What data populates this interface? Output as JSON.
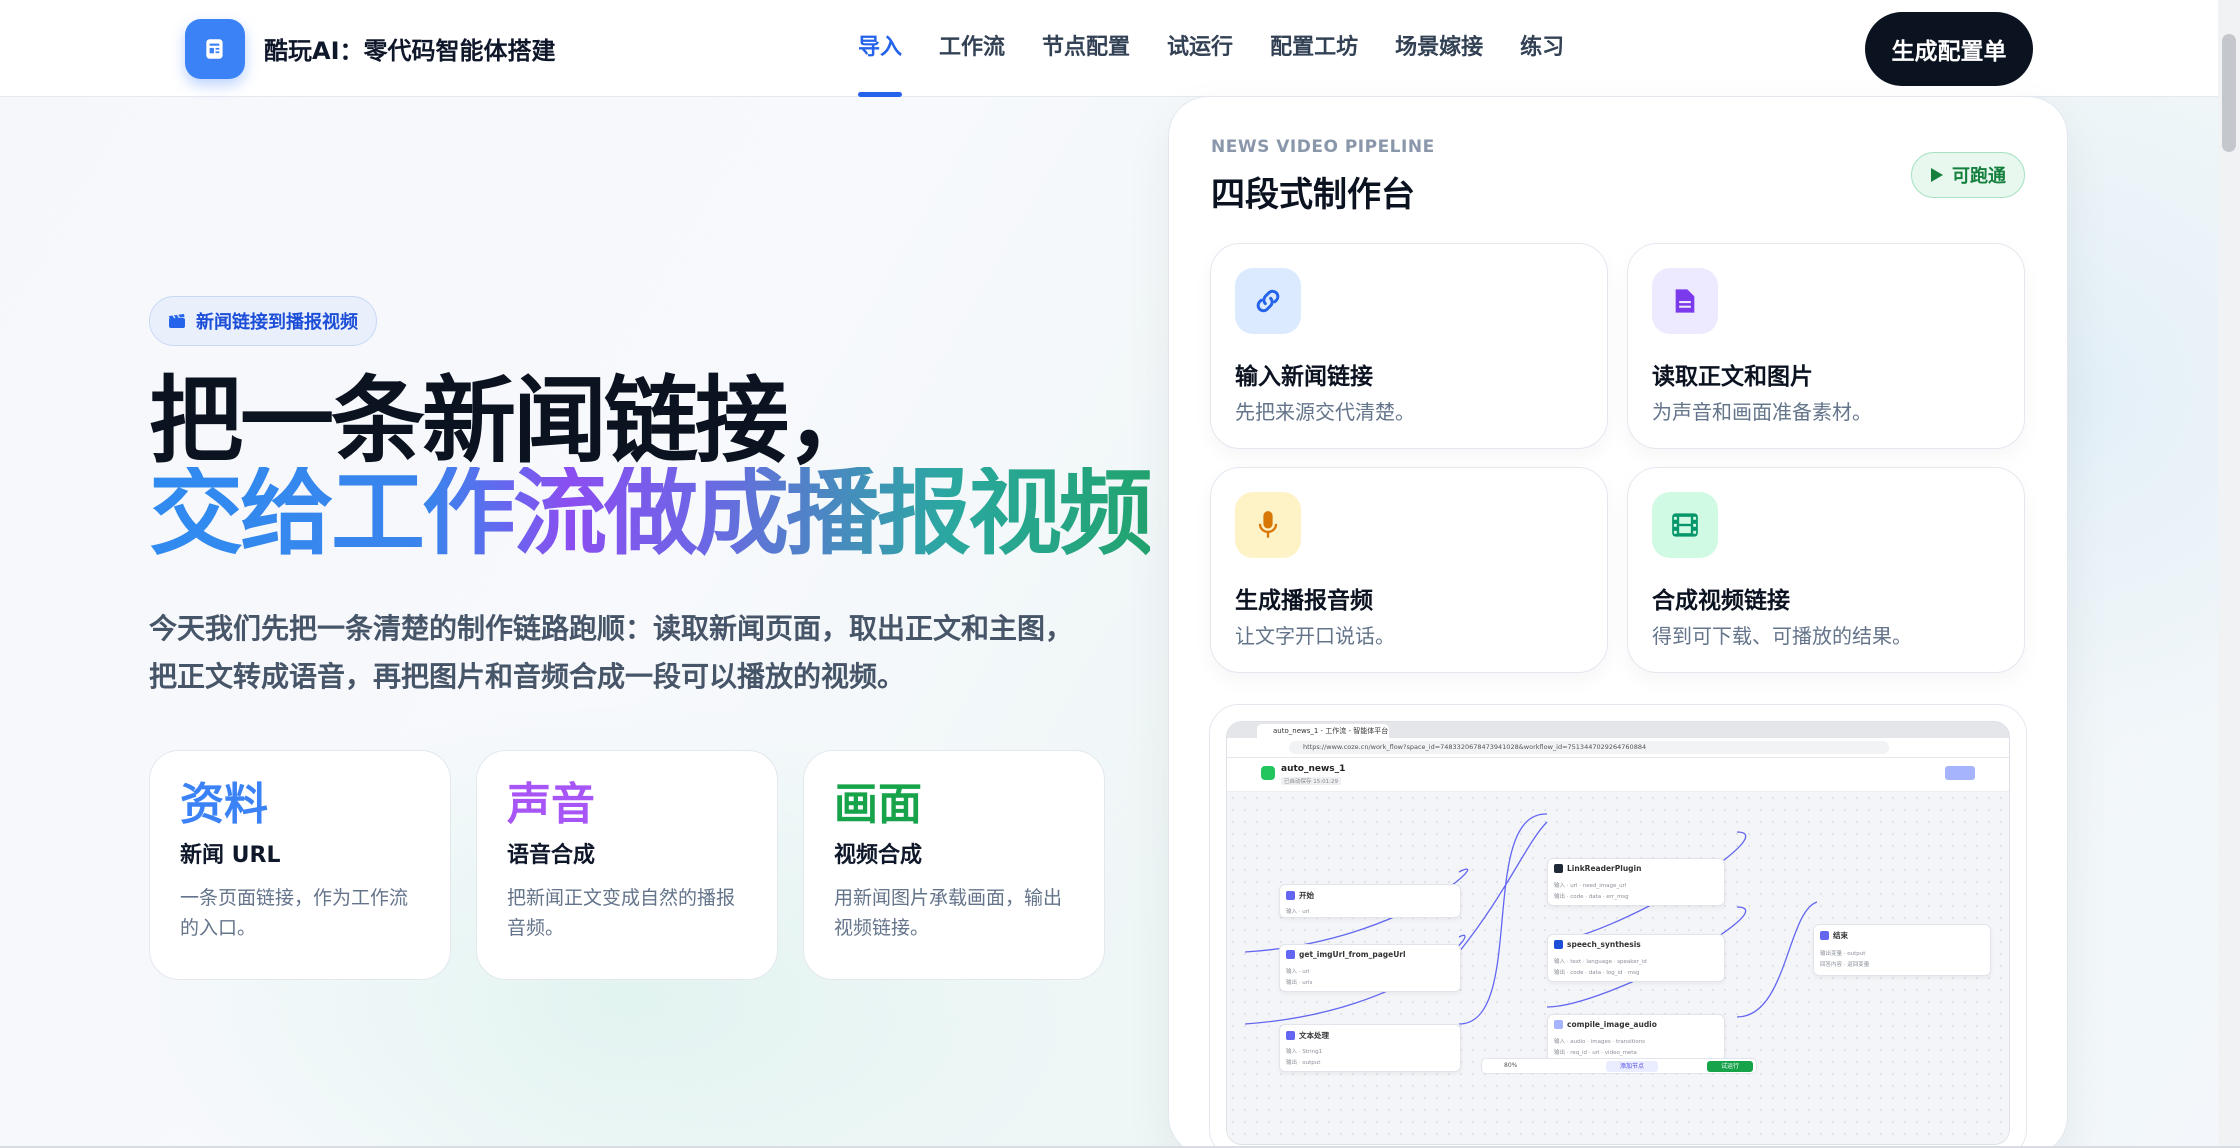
{
  "header": {
    "brand": "酷玩AI：零代码智能体搭建",
    "nav": [
      "导入",
      "工作流",
      "节点配置",
      "试运行",
      "配置工坊",
      "场景嫁接",
      "练习"
    ],
    "active_nav": "导入",
    "cta": "生成配置单"
  },
  "hero": {
    "pill": "新闻链接到播报视频",
    "title_line1": "把一条新闻链接，",
    "title_line2": "交给工作流做成播报视频",
    "lead": "今天我们先把一条清楚的制作链路跑顺：读取新闻页面，取出正文和主图，把正文转成语音，再把图片和音频合成一段可以播放的视频。",
    "features": [
      {
        "big": "资料",
        "sub": "新闻 URL",
        "desc": "一条页面链接，作为工作流的入口。",
        "color": "#3b82f6"
      },
      {
        "big": "声音",
        "sub": "语音合成",
        "desc": "把新闻正文变成自然的播报音频。",
        "color": "#a855f7"
      },
      {
        "big": "画面",
        "sub": "视频合成",
        "desc": "用新闻图片承载画面，输出视频链接。",
        "color": "#16a34a"
      }
    ]
  },
  "panel": {
    "eyebrow": "NEWS VIDEO PIPELINE",
    "title": "四段式制作台",
    "badge": "可跑通",
    "steps": [
      {
        "title": "输入新闻链接",
        "desc": "先把来源交代清楚。",
        "icon": "link-icon",
        "bg": "#dbeafe",
        "fg": "#2563eb"
      },
      {
        "title": "读取正文和图片",
        "desc": "为声音和画面准备素材。",
        "icon": "document-icon",
        "bg": "#ede9fe",
        "fg": "#7c3aed"
      },
      {
        "title": "生成播报音频",
        "desc": "让文字开口说话。",
        "icon": "microphone-icon",
        "bg": "#fef3c7",
        "fg": "#d97706"
      },
      {
        "title": "合成视频链接",
        "desc": "得到可下载、可播放的结果。",
        "icon": "film-icon",
        "bg": "#d1fae5",
        "fg": "#059669"
      }
    ],
    "screenshot": {
      "tab_title": "auto_news_1 - 工作流 - 智能体平台",
      "url": "https://www.coze.cn/work_flow?space_id=7483320678473941028&workflow_id=7513447029264760884",
      "workflow_name": "auto_news_1",
      "workflow_sub": "已自动保存 15:01:29",
      "nodes": {
        "start": "开始",
        "get_img": "get_imgUrl_from_pageUrl",
        "text_proc": "文本处理",
        "link_reader": "LinkReaderPlugin",
        "speech": "speech_synthesis",
        "compile": "compile_image_audio",
        "end": "结束"
      },
      "zoom": "80%",
      "add_node": "添加节点",
      "trial_run": "试运行"
    }
  }
}
